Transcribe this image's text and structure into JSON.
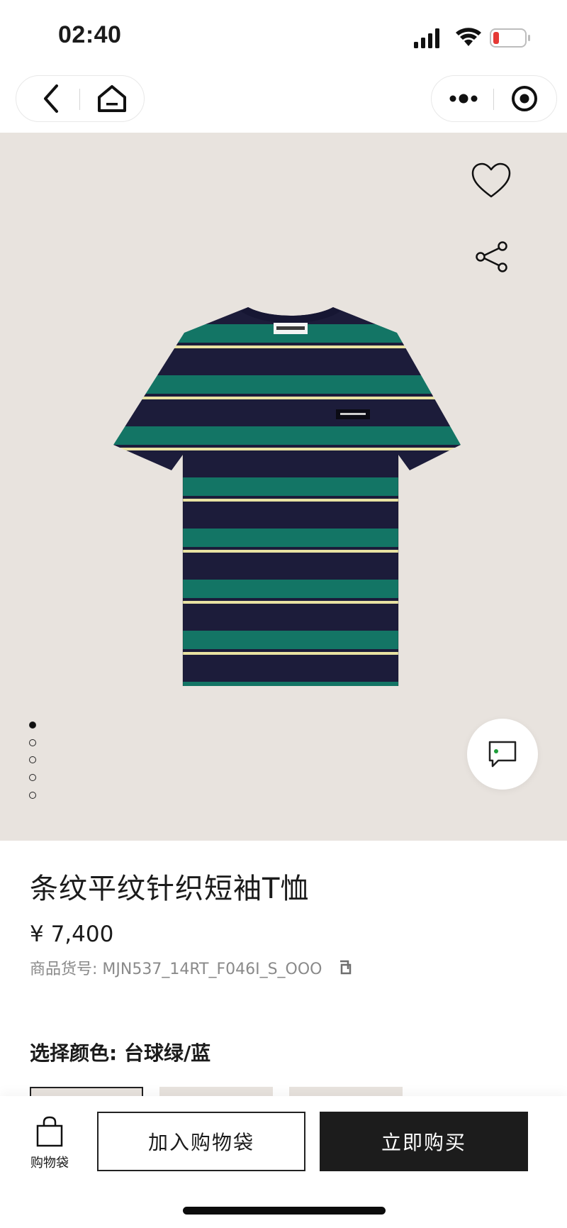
{
  "status_bar": {
    "time": "02:40",
    "battery_color": "#e53935"
  },
  "nav": {
    "back_icon": "chevron-left-icon",
    "home_icon": "home-icon",
    "more_icon": "more-dots-icon",
    "close_icon": "target-circle-icon"
  },
  "hero": {
    "background": "#e8e3de",
    "image_count": 5,
    "active_index": 0,
    "wishlist_icon": "heart-icon",
    "share_icon": "share-icon",
    "chat_icon": "chat-bubble-icon"
  },
  "product": {
    "title": "条纹平纹针织短袖T恤",
    "price": "¥ 7,400",
    "sku_label": "商品货号: MJN537_14RT_F046I_S_OOO",
    "copy_icon": "copy-icon"
  },
  "color_select": {
    "label": "选择颜色: 台球绿/蓝",
    "selected_index": 0
  },
  "bottom_bar": {
    "bag_label": "购物袋",
    "add_to_bag": "加入购物袋",
    "buy_now": "立即购买"
  },
  "colors": {
    "navy": "#1c1c3a",
    "green": "#137565",
    "stripe_yellow": "#e8e2a2",
    "primary_button": "#1c1c1c"
  }
}
